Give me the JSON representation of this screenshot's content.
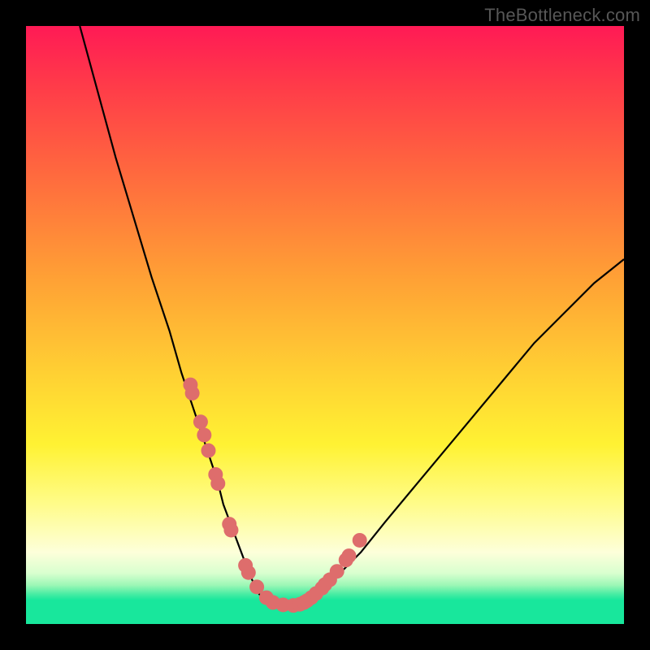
{
  "watermark": "TheBottleneck.com",
  "chart_data": {
    "type": "line",
    "title": "",
    "xlabel": "",
    "ylabel": "",
    "xlim": [
      0,
      100
    ],
    "ylim": [
      0,
      100
    ],
    "grid": false,
    "legend": false,
    "series": [
      {
        "name": "curve",
        "color": "#000000",
        "x": [
          9,
          12,
          15,
          18,
          21,
          24,
          26,
          28,
          30,
          32,
          33,
          34.5,
          36,
          37.5,
          39,
          41,
          43,
          45,
          48,
          52,
          56,
          60,
          65,
          70,
          75,
          80,
          85,
          90,
          95,
          100
        ],
        "y": [
          100,
          89,
          78,
          68,
          58,
          49,
          42,
          36,
          30,
          24,
          20,
          16,
          12,
          8,
          5,
          3,
          3,
          3.5,
          5,
          8,
          12,
          17,
          23,
          29,
          35,
          41,
          47,
          52,
          57,
          61
        ]
      },
      {
        "name": "markers",
        "type": "scatter",
        "color": "#de6d6c",
        "x": [
          27.5,
          27.8,
          29.2,
          29.8,
          30.5,
          31.7,
          32.1,
          34.0,
          34.3,
          36.7,
          37.2,
          38.6,
          40.2,
          41.3,
          43.0,
          44.7,
          45.8,
          46.5,
          47.0,
          47.7,
          48.5,
          49.5,
          50.0,
          50.8,
          52.0,
          53.5,
          54.0,
          55.8
        ],
        "y": [
          40.0,
          38.6,
          33.8,
          31.6,
          29.0,
          25.0,
          23.5,
          16.7,
          15.7,
          9.8,
          8.6,
          6.2,
          4.4,
          3.6,
          3.2,
          3.1,
          3.3,
          3.6,
          3.9,
          4.4,
          5.1,
          6.0,
          6.6,
          7.4,
          8.8,
          10.7,
          11.4,
          14.0
        ]
      }
    ]
  }
}
